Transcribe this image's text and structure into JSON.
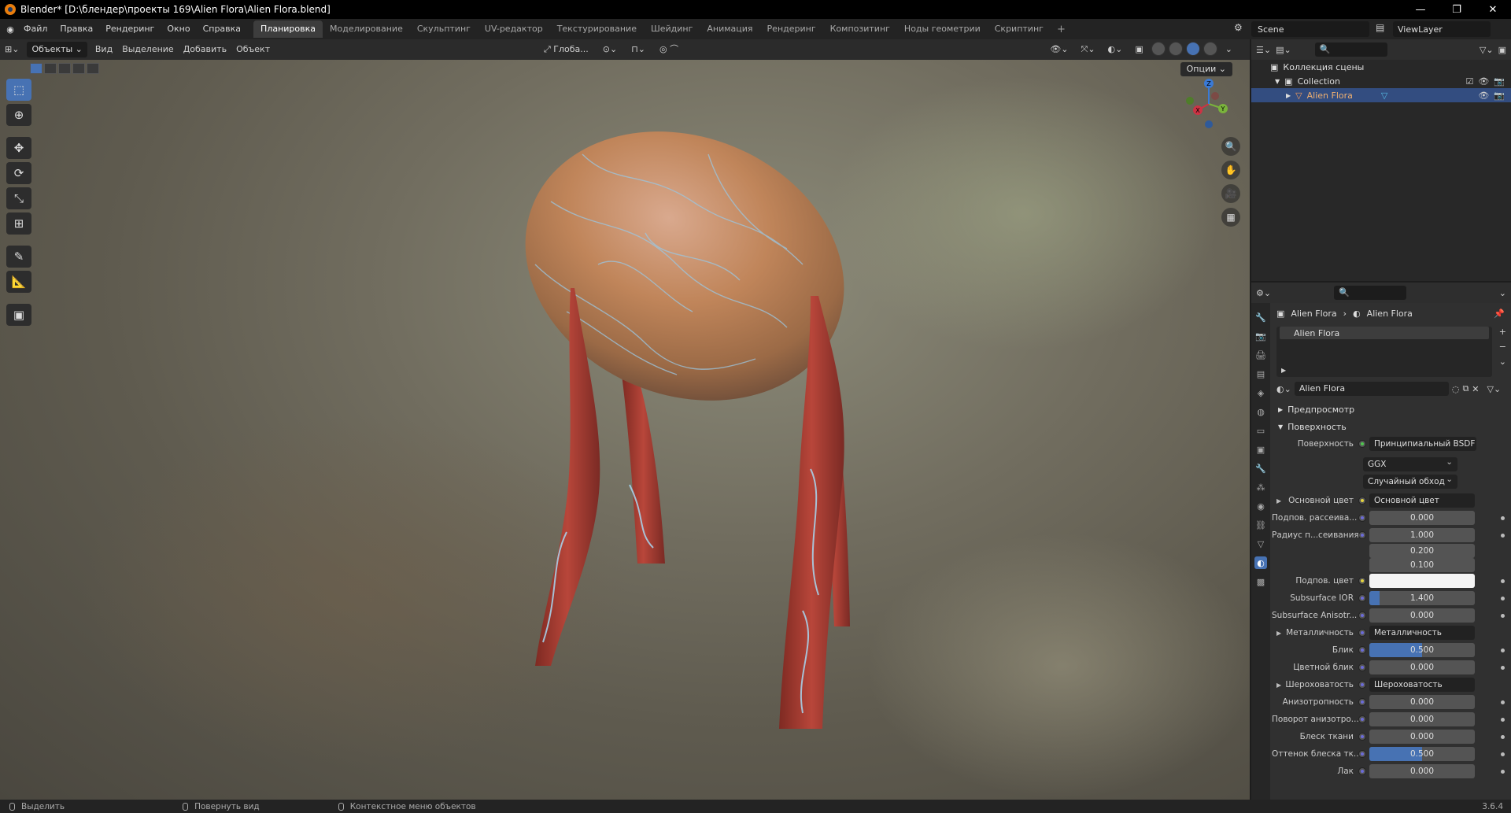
{
  "window": {
    "title": "Blender* [D:\\блендер\\проекты 169\\Alien Flora\\Alien Flora.blend]",
    "minimize": "—",
    "maximize": "❐",
    "close": "✕"
  },
  "menu": [
    "Файл",
    "Правка",
    "Рендеринг",
    "Окно",
    "Справка"
  ],
  "workspaces": [
    {
      "label": "Планировка",
      "active": true
    },
    {
      "label": "Моделирование"
    },
    {
      "label": "Скульптинг"
    },
    {
      "label": "UV-редактор"
    },
    {
      "label": "Текстурирование"
    },
    {
      "label": "Шейдинг"
    },
    {
      "label": "Анимация"
    },
    {
      "label": "Рендеринг"
    },
    {
      "label": "Композитинг"
    },
    {
      "label": "Ноды геометрии"
    },
    {
      "label": "Скриптинг"
    }
  ],
  "workspace_add": "+",
  "scene": {
    "name": "Scene",
    "view_layer": "ViewLayer"
  },
  "viewport_header": {
    "mode": "Объекты",
    "menus": [
      "Вид",
      "Выделение",
      "Добавить",
      "Объект"
    ],
    "transform_orientation": "Глоба...",
    "options": "Опции"
  },
  "gizmo": {
    "x": "X",
    "y": "Y",
    "z": "Z"
  },
  "outliner": {
    "search_placeholder": "",
    "rows": [
      {
        "label": "Коллекция сцены"
      },
      {
        "label": "Collection"
      },
      {
        "label": "Alien Flora",
        "selected": true
      }
    ]
  },
  "properties": {
    "breadcrumb": [
      "Alien Flora",
      "Alien Flora"
    ],
    "slot": "Alien Flora",
    "material_name": "Alien Flora",
    "panels": {
      "preview": "Предпросмотр",
      "surface": "Поверхность"
    },
    "surface_shader_label": "Поверхность",
    "surface_shader": "Принципиальный BSDF",
    "distribution": "GGX",
    "subsurface_method": "Случайный обход",
    "rows": [
      {
        "label": "Основной цвет",
        "value": "Основной цвет",
        "type": "link",
        "expand": true
      },
      {
        "label": "Подпов. рассеива...",
        "value": "0.000",
        "type": "num"
      },
      {
        "label": "Радиус п...сеивания",
        "value": "1.000",
        "type": "num"
      },
      {
        "label": "",
        "value": "0.200",
        "type": "num"
      },
      {
        "label": "",
        "value": "0.100",
        "type": "num"
      },
      {
        "label": "Подпов. цвет",
        "value": "",
        "type": "color"
      },
      {
        "label": "Subsurface IOR",
        "value": "1.400",
        "type": "num",
        "fill": 0.1
      },
      {
        "label": "Subsurface Anisotr...",
        "value": "0.000",
        "type": "num"
      },
      {
        "label": "Металличность",
        "value": "Металличность",
        "type": "link",
        "expand": true
      },
      {
        "label": "Блик",
        "value": "0.500",
        "type": "num",
        "fill": 0.5
      },
      {
        "label": "Цветной блик",
        "value": "0.000",
        "type": "num"
      },
      {
        "label": "Шероховатость",
        "value": "Шероховатость",
        "type": "link",
        "expand": true
      },
      {
        "label": "Анизотропность",
        "value": "0.000",
        "type": "num"
      },
      {
        "label": "Поворот анизотро...",
        "value": "0.000",
        "type": "num"
      },
      {
        "label": "Блеск ткани",
        "value": "0.000",
        "type": "num"
      },
      {
        "label": "Оттенок блеска тк...",
        "value": "0.500",
        "type": "num",
        "fill": 0.5
      },
      {
        "label": "Лак",
        "value": "0.000",
        "type": "num"
      }
    ]
  },
  "statusbar": {
    "select": "Выделить",
    "rotate": "Повернуть вид",
    "context_menu": "Контекстное меню объектов",
    "version": "3.6.4"
  }
}
